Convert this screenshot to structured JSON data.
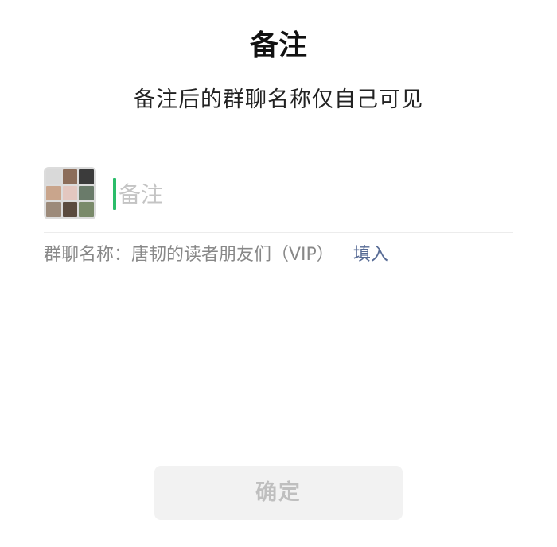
{
  "header": {
    "title": "备注",
    "subtitle": "备注后的群聊名称仅自己可见"
  },
  "remark": {
    "placeholder": "备注",
    "value": ""
  },
  "avatar": {
    "icon": "group-avatar-icon",
    "cell_colors": [
      "#d9d9d9",
      "#8b6d5a",
      "#3b3b3b",
      "#c9a58c",
      "#e3c7c0",
      "#6a7b6a",
      "#9c8a7a",
      "#5a4a3e",
      "#7a8a6a"
    ]
  },
  "group_name": {
    "label": "群聊名称：唐韧的读者朋友们（VIP）",
    "fill_label": "填入"
  },
  "actions": {
    "confirm_label": "确定"
  },
  "colors": {
    "cursor": "#2bbd6a",
    "link": "#576b95",
    "button_bg": "#f2f2f2",
    "button_text": "#bfbfbf"
  }
}
